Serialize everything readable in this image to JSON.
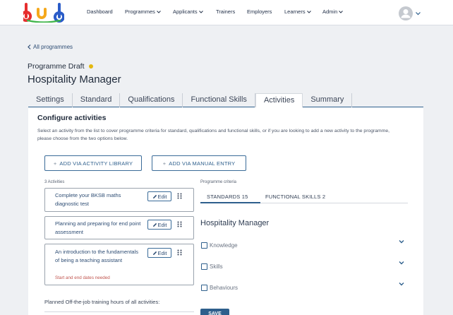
{
  "app": {
    "logo_text": "bud"
  },
  "nav": {
    "items": [
      {
        "label": "Dashboard",
        "has_dropdown": false
      },
      {
        "label": "Programmes",
        "has_dropdown": true
      },
      {
        "label": "Applicants",
        "has_dropdown": true
      },
      {
        "label": "Trainers",
        "has_dropdown": false
      },
      {
        "label": "Employers",
        "has_dropdown": false
      },
      {
        "label": "Learners",
        "has_dropdown": true
      },
      {
        "label": "Admin",
        "has_dropdown": true
      }
    ]
  },
  "header": {
    "back_link": "All programmes",
    "status": "Programme Draft",
    "status_color": "#e3b80f",
    "title": "Hospitality Manager"
  },
  "tabs": [
    {
      "label": "Settings",
      "active": false
    },
    {
      "label": "Standard",
      "active": false
    },
    {
      "label": "Qualifications",
      "active": false
    },
    {
      "label": "Functional Skills",
      "active": false
    },
    {
      "label": "Activities",
      "active": true
    },
    {
      "label": "Summary",
      "active": false
    }
  ],
  "configure": {
    "heading": "Configure activities",
    "description": "Select an activity from the list to cover programme criteria for standard, qualifications and functional skills, or if you are looking to add a new activity to the programme, please choose from the two options below.",
    "add_library": "ADD VIA ACTIVITY LIBRARY",
    "add_manual": "ADD VIA MANUAL ENTRY"
  },
  "activities": {
    "count_label": "3 Activities",
    "edit_label": "Edit",
    "items": [
      {
        "title": "Complete your BKSB maths diagnostic test",
        "warning": ""
      },
      {
        "title": "Planning and preparing for end point assessment",
        "warning": ""
      },
      {
        "title": "An introduction to the fundamentals of being a teaching assistant",
        "warning": "Start and end dates needed"
      }
    ],
    "planned_label": "Planned Off-the-job training hours of all activities:"
  },
  "criteria": {
    "label": "Programme criteria",
    "tabs": [
      {
        "label": "STANDARDS 15",
        "active": true
      },
      {
        "label": "FUNCTIONAL SKILLS 2",
        "active": false
      }
    ],
    "standard_title": "Hospitality Manager",
    "rows": [
      {
        "label": "Knowledge"
      },
      {
        "label": "Skills"
      },
      {
        "label": "Behaviours"
      }
    ],
    "save_label": "SAVE"
  },
  "colors": {
    "accent": "#2e5f8c",
    "warning": "#c0544e"
  }
}
